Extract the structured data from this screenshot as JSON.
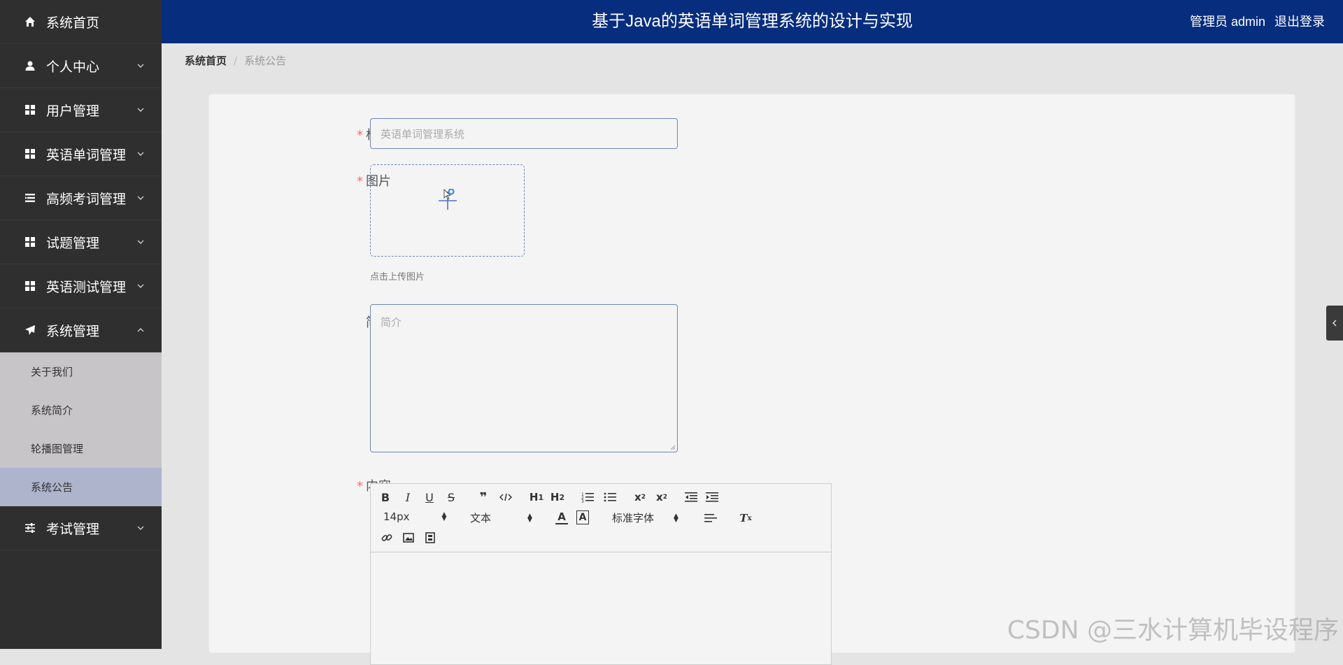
{
  "header": {
    "title": "基于Java的英语单词管理系统的设计与实现",
    "user_label": "管理员 admin",
    "logout_label": "退出登录"
  },
  "sidebar": {
    "items": [
      {
        "label": "系统首页",
        "icon": "home-icon"
      },
      {
        "label": "个人中心",
        "icon": "person-icon"
      },
      {
        "label": "用户管理",
        "icon": "grid-icon"
      },
      {
        "label": "英语单词管理",
        "icon": "grid-icon"
      },
      {
        "label": "高频考词管理",
        "icon": "list-icon"
      },
      {
        "label": "试题管理",
        "icon": "grid-icon"
      },
      {
        "label": "英语测试管理",
        "icon": "grid-icon"
      },
      {
        "label": "系统管理",
        "icon": "paper-plane-icon"
      },
      {
        "label": "考试管理",
        "icon": "sliders-icon"
      }
    ],
    "submenu": [
      {
        "label": "关于我们"
      },
      {
        "label": "系统简介"
      },
      {
        "label": "轮播图管理"
      },
      {
        "label": "系统公告",
        "active": true
      }
    ]
  },
  "breadcrumb": {
    "home": "系统首页",
    "separator": "/",
    "current": "系统公告"
  },
  "form": {
    "title_label": "标题",
    "title_placeholder": "英语单词管理系统",
    "image_label": "图片",
    "upload_tip": "点击上传图片",
    "intro_label": "简介",
    "intro_placeholder": "简介",
    "content_label": "内容"
  },
  "editor": {
    "font_size": "14px",
    "block_type": "文本",
    "font_family": "标准字体",
    "buttons": [
      "bold",
      "italic",
      "underline",
      "strike",
      "blockquote",
      "code-block",
      "h1",
      "h2",
      "ordered-list",
      "bullet-list",
      "subscript",
      "superscript",
      "outdent",
      "indent",
      "font-color",
      "background-color",
      "align",
      "clean",
      "link",
      "image",
      "video"
    ]
  },
  "watermark": "CSDN @三水计算机毕设程序",
  "colors": {
    "header_bg": "#072d7e",
    "sidebar_bg": "#2f2f2f",
    "submenu_bg": "#c8c5c8",
    "submenu_active": "#adb4cc",
    "required": "#f56c6c",
    "accent": "#409eff"
  }
}
